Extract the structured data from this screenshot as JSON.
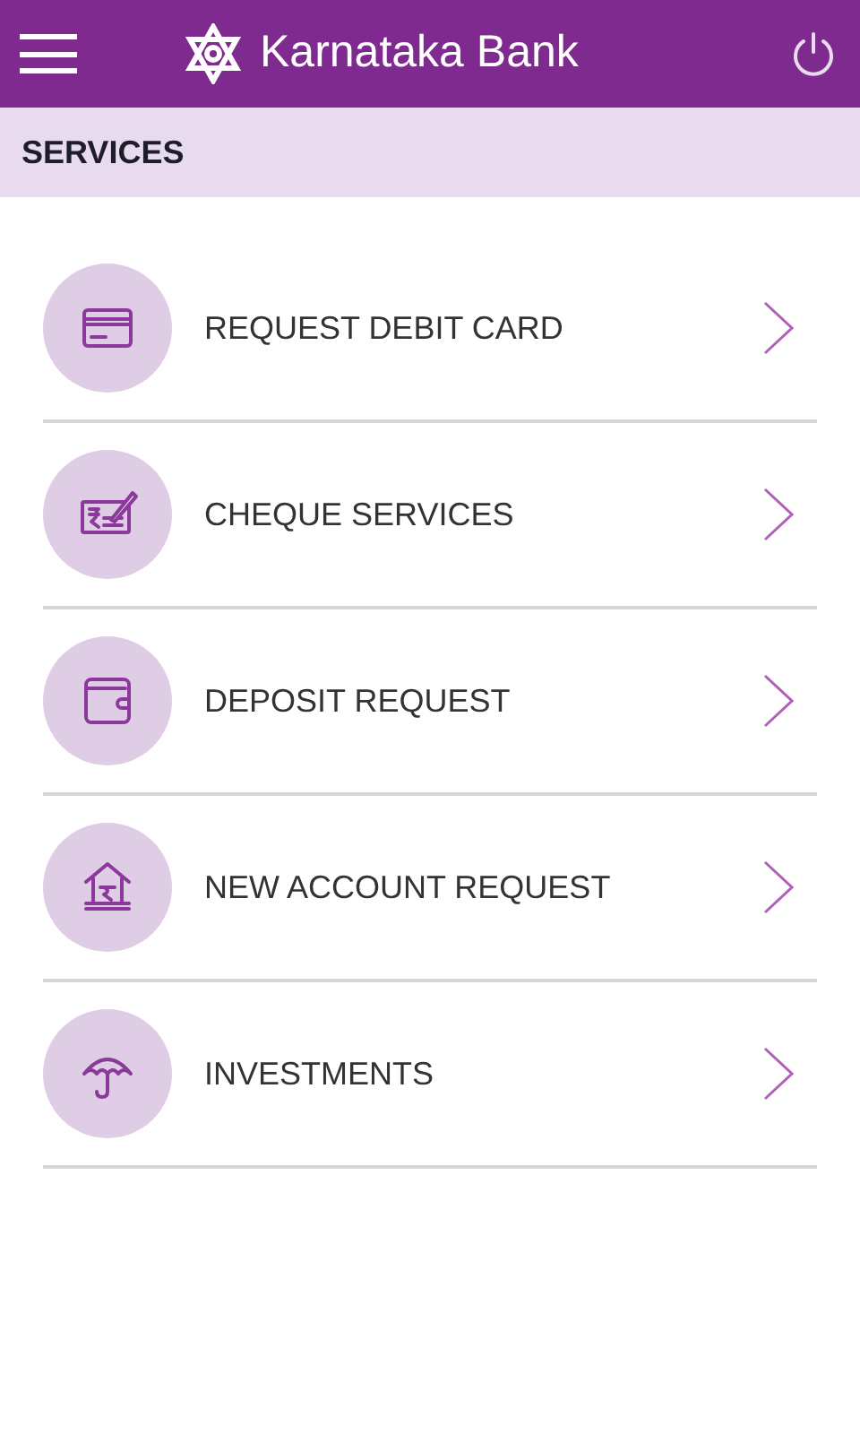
{
  "header": {
    "title": "Karnataka Bank"
  },
  "section": {
    "title": "SERVICES"
  },
  "services": [
    {
      "label": "REQUEST DEBIT CARD",
      "kind": "card"
    },
    {
      "label": "CHEQUE SERVICES",
      "kind": "cheque"
    },
    {
      "label": "DEPOSIT REQUEST",
      "kind": "wallet"
    },
    {
      "label": "NEW ACCOUNT REQUEST",
      "kind": "bank"
    },
    {
      "label": "INVESTMENTS",
      "kind": "umbrella"
    }
  ]
}
